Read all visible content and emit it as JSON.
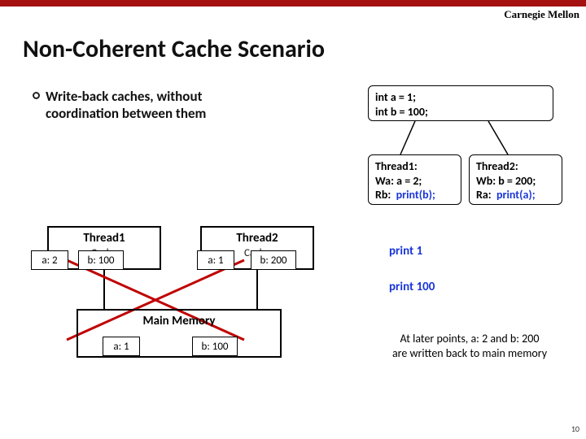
{
  "brand": "Carnegie Mellon",
  "title": "Non-Coherent Cache Scenario",
  "bullet": {
    "line1": "Write-back caches, without",
    "line2": "coordination between them"
  },
  "init": {
    "l1": "int a = 1;",
    "l2": "int b = 100;"
  },
  "thread1": {
    "name": "Thread1:",
    "wa": "Wa:  a = 2;",
    "rb_lbl": "Rb:",
    "rb_call": "print(b);"
  },
  "thread2": {
    "name": "Thread2:",
    "wb": "Wb:  b = 200;",
    "ra_lbl": "Ra:",
    "ra_call": "print(a);"
  },
  "cache1": {
    "label": "Thread1",
    "sub": "Cache",
    "a": "a: 2",
    "b": "b: 100"
  },
  "cache2": {
    "label": "Thread2",
    "sub": "Cache",
    "a": "a: 1",
    "b": "b: 200"
  },
  "mainmem": {
    "label": "Main Memory",
    "a": "a: 1",
    "b": "b: 100"
  },
  "print1": "print 1",
  "print2": "print 100",
  "note": {
    "l1": "At later points, a: 2 and b: 200",
    "l2": "are written back to main memory"
  },
  "pagenum": "10"
}
